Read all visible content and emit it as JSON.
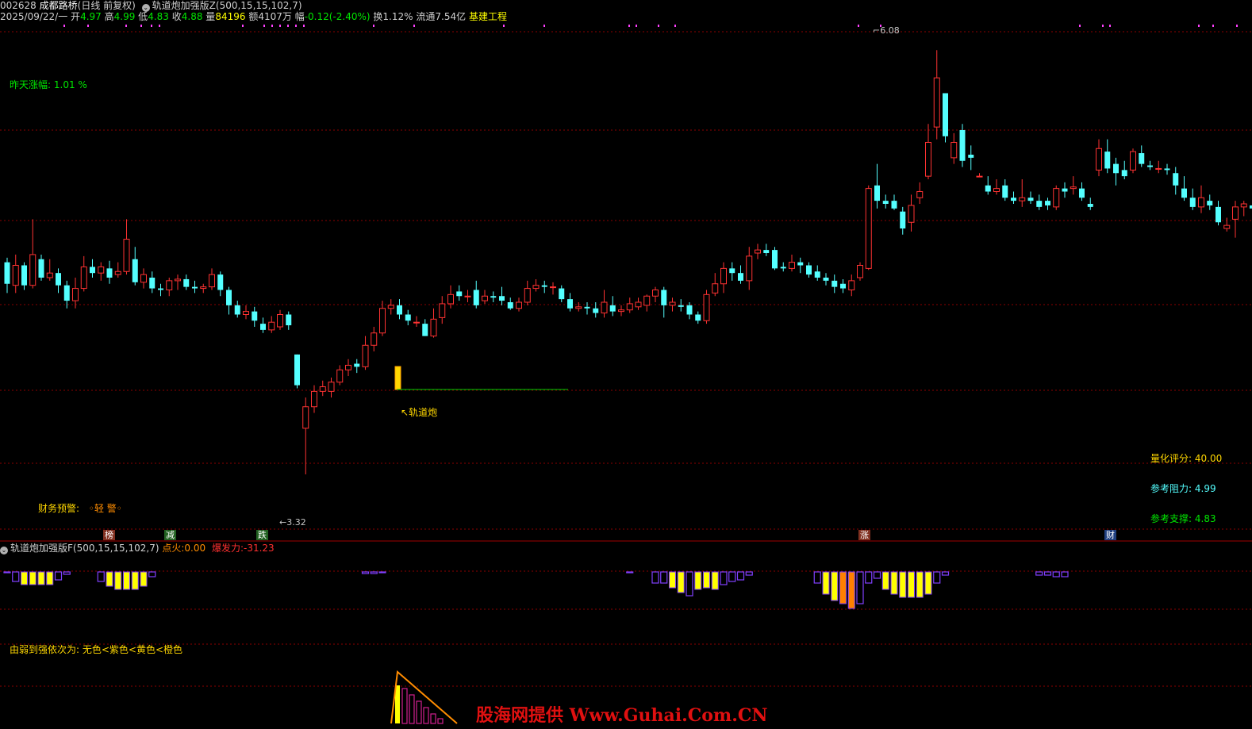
{
  "header": {
    "stock_code": "002628",
    "stock_name": "成都路桥",
    "period_mode": "(日线 前复权)",
    "indicator_main": "轨道炮加强版Z(500,15,15,102,7)",
    "date": "2025/09/22/一",
    "open_label": "开",
    "open": "4.97",
    "high_label": "高",
    "high": "4.99",
    "low_label": "低",
    "low": "4.83",
    "close_label": "收",
    "close": "4.88",
    "vol_label": "量",
    "vol": "84196",
    "amount": "额4107万",
    "chg_label": "幅",
    "chg": "-0.12(-2.40%)",
    "turnover": "换1.12%",
    "float_cap": "流通7.54亿",
    "sector": "基建工程"
  },
  "main_annotations": {
    "yesterday_label": "昨天涨幅:",
    "yesterday_value": "1.01 %",
    "max_price": "6.08",
    "min_price": "3.32",
    "signal_label": "轨道炮",
    "finance_warn_label": "财务预警:",
    "finance_warn_value": "◦轻 警◦",
    "score_label": "量化评分:",
    "score_value": "40.00",
    "resist_label": "参考阻力:",
    "resist_value": "4.99",
    "support_label": "参考支撑:",
    "support_value": "4.83"
  },
  "event_tags": [
    "榜",
    "减",
    "跌",
    "涨",
    "财"
  ],
  "sub_indicator": {
    "title": "轨道炮加强版F(500,15,15,102,7)",
    "fire_label": "点火:",
    "fire_value": "0.00",
    "burst_label": "爆发力:",
    "burst_value": "-31.23",
    "legend_note": "由弱到强依次为: 无色<紫色<黄色<橙色"
  },
  "watermark": "股海网提供 Www.Guhai.Com.CN",
  "colors": {
    "up": "#ff3232",
    "down": "#54ffff",
    "grid": "#8b0000",
    "yellow": "#ffff00",
    "purple": "#8040ff",
    "orange": "#ff8000",
    "text_green": "#00e600",
    "text_gold": "#ffd700"
  },
  "chart_data": {
    "type": "candlestick",
    "ylim": [
      3.0,
      6.2
    ],
    "candles": [
      [
        4.7,
        4.56,
        4.73,
        4.5
      ],
      [
        4.55,
        4.68,
        4.75,
        4.5
      ],
      [
        4.68,
        4.55,
        4.7,
        4.52
      ],
      [
        4.55,
        4.75,
        4.98,
        4.53
      ],
      [
        4.72,
        4.6,
        4.75,
        4.58
      ],
      [
        4.6,
        4.63,
        4.72,
        4.58
      ],
      [
        4.63,
        4.55,
        4.66,
        4.5
      ],
      [
        4.55,
        4.45,
        4.58,
        4.4
      ],
      [
        4.45,
        4.53,
        4.6,
        4.4
      ],
      [
        4.53,
        4.67,
        4.74,
        4.51
      ],
      [
        4.67,
        4.63,
        4.72,
        4.6
      ],
      [
        4.63,
        4.67,
        4.7,
        4.58
      ],
      [
        4.66,
        4.6,
        4.71,
        4.56
      ],
      [
        4.62,
        4.64,
        4.7,
        4.6
      ],
      [
        4.64,
        4.85,
        4.98,
        4.62
      ],
      [
        4.72,
        4.57,
        4.8,
        4.55
      ],
      [
        4.57,
        4.62,
        4.66,
        4.53
      ],
      [
        4.6,
        4.53,
        4.64,
        4.5
      ],
      [
        4.53,
        4.52,
        4.56,
        4.48
      ],
      [
        4.52,
        4.58,
        4.6,
        4.48
      ],
      [
        4.58,
        4.59,
        4.62,
        4.52
      ],
      [
        4.59,
        4.54,
        4.62,
        4.52
      ],
      [
        4.54,
        4.53,
        4.58,
        4.5
      ],
      [
        4.53,
        4.54,
        4.56,
        4.5
      ],
      [
        4.54,
        4.62,
        4.66,
        4.52
      ],
      [
        4.62,
        4.52,
        4.64,
        4.48
      ],
      [
        4.52,
        4.42,
        4.54,
        4.36
      ],
      [
        4.42,
        4.36,
        4.45,
        4.34
      ],
      [
        4.36,
        4.38,
        4.42,
        4.33
      ],
      [
        4.38,
        4.32,
        4.41,
        4.28
      ],
      [
        4.3,
        4.26,
        4.34,
        4.24
      ],
      [
        4.26,
        4.31,
        4.35,
        4.24
      ],
      [
        4.28,
        4.36,
        4.39,
        4.26
      ],
      [
        4.36,
        4.29,
        4.38,
        4.26
      ],
      [
        4.1,
        3.9,
        4.1,
        3.88
      ],
      [
        3.62,
        3.76,
        3.82,
        3.32
      ],
      [
        3.76,
        3.86,
        3.9,
        3.72
      ],
      [
        3.86,
        3.89,
        3.93,
        3.83
      ],
      [
        3.86,
        3.92,
        3.95,
        3.82
      ],
      [
        3.92,
        4.0,
        4.03,
        3.9
      ],
      [
        4.0,
        4.03,
        4.07,
        3.96
      ],
      [
        4.04,
        4.02,
        4.07,
        3.98
      ],
      [
        4.02,
        4.16,
        4.22,
        4.0
      ],
      [
        4.16,
        4.24,
        4.28,
        4.12
      ],
      [
        4.24,
        4.4,
        4.45,
        4.22
      ],
      [
        4.4,
        4.42,
        4.46,
        4.36
      ],
      [
        4.42,
        4.36,
        4.46,
        4.33
      ],
      [
        4.36,
        4.32,
        4.39,
        4.29
      ],
      [
        4.31,
        4.31,
        4.35,
        4.28
      ],
      [
        4.3,
        4.22,
        4.33,
        4.22
      ],
      [
        4.22,
        4.33,
        4.4,
        4.21
      ],
      [
        4.34,
        4.43,
        4.48,
        4.3
      ],
      [
        4.43,
        4.49,
        4.55,
        4.4
      ],
      [
        4.51,
        4.48,
        4.55,
        4.45
      ],
      [
        4.48,
        4.48,
        4.52,
        4.44
      ],
      [
        4.52,
        4.42,
        4.58,
        4.4
      ],
      [
        4.45,
        4.48,
        4.52,
        4.43
      ],
      [
        4.48,
        4.47,
        4.51,
        4.44
      ],
      [
        4.48,
        4.45,
        4.54,
        4.42
      ],
      [
        4.44,
        4.4,
        4.47,
        4.39
      ],
      [
        4.4,
        4.44,
        4.47,
        4.38
      ],
      [
        4.44,
        4.53,
        4.58,
        4.42
      ],
      [
        4.53,
        4.55,
        4.59,
        4.51
      ],
      [
        4.55,
        4.54,
        4.58,
        4.5
      ],
      [
        4.54,
        4.54,
        4.57,
        4.49
      ],
      [
        4.53,
        4.46,
        4.55,
        4.44
      ],
      [
        4.46,
        4.4,
        4.5,
        4.38
      ],
      [
        4.4,
        4.41,
        4.44,
        4.38
      ],
      [
        4.41,
        4.4,
        4.44,
        4.36
      ],
      [
        4.4,
        4.37,
        4.44,
        4.34
      ],
      [
        4.37,
        4.44,
        4.52,
        4.34
      ],
      [
        4.42,
        4.38,
        4.48,
        4.35
      ],
      [
        4.38,
        4.39,
        4.42,
        4.35
      ],
      [
        4.39,
        4.43,
        4.47,
        4.37
      ],
      [
        4.41,
        4.44,
        4.47,
        4.39
      ],
      [
        4.42,
        4.48,
        4.49,
        4.38
      ],
      [
        4.48,
        4.52,
        4.54,
        4.44
      ],
      [
        4.52,
        4.42,
        4.54,
        4.34
      ],
      [
        4.42,
        4.44,
        4.47,
        4.38
      ],
      [
        4.42,
        4.41,
        4.46,
        4.38
      ],
      [
        4.42,
        4.36,
        4.44,
        4.33
      ],
      [
        4.36,
        4.32,
        4.38,
        4.3
      ],
      [
        4.32,
        4.49,
        4.52,
        4.3
      ],
      [
        4.5,
        4.56,
        4.63,
        4.48
      ],
      [
        4.56,
        4.66,
        4.7,
        4.5
      ],
      [
        4.66,
        4.63,
        4.7,
        4.58
      ],
      [
        4.63,
        4.58,
        4.68,
        4.56
      ],
      [
        4.58,
        4.74,
        4.8,
        4.52
      ],
      [
        4.76,
        4.78,
        4.82,
        4.72
      ],
      [
        4.78,
        4.76,
        4.82,
        4.74
      ],
      [
        4.78,
        4.66,
        4.8,
        4.65
      ],
      [
        4.67,
        4.66,
        4.7,
        4.64
      ],
      [
        4.66,
        4.7,
        4.75,
        4.64
      ],
      [
        4.7,
        4.68,
        4.73,
        4.63
      ],
      [
        4.68,
        4.62,
        4.7,
        4.6
      ],
      [
        4.64,
        4.6,
        4.68,
        4.58
      ],
      [
        4.6,
        4.58,
        4.63,
        4.55
      ],
      [
        4.58,
        4.54,
        4.62,
        4.5
      ],
      [
        4.56,
        4.53,
        4.59,
        4.5
      ],
      [
        4.52,
        4.58,
        4.62,
        4.48
      ],
      [
        4.6,
        4.68,
        4.7,
        4.58
      ],
      [
        4.66,
        5.18,
        5.2,
        4.65
      ],
      [
        5.2,
        5.1,
        5.34,
        5.05
      ],
      [
        5.1,
        5.08,
        5.14,
        5.05
      ],
      [
        5.1,
        5.05,
        5.14,
        5.04
      ],
      [
        5.03,
        4.92,
        5.06,
        4.88
      ],
      [
        4.96,
        5.07,
        5.14,
        4.9
      ],
      [
        5.12,
        5.16,
        5.22,
        5.08
      ],
      [
        5.26,
        5.48,
        5.6,
        5.24
      ],
      [
        5.58,
        5.9,
        6.08,
        5.5
      ],
      [
        5.8,
        5.52,
        5.8,
        5.48
      ],
      [
        5.38,
        5.48,
        5.54,
        5.34
      ],
      [
        5.56,
        5.36,
        5.6,
        5.32
      ],
      [
        5.4,
        5.38,
        5.46,
        5.3
      ],
      [
        5.26,
        5.26,
        5.28,
        5.26
      ],
      [
        5.2,
        5.16,
        5.26,
        5.14
      ],
      [
        5.16,
        5.18,
        5.24,
        5.14
      ],
      [
        5.2,
        5.12,
        5.24,
        5.1
      ],
      [
        5.12,
        5.1,
        5.16,
        5.08
      ],
      [
        5.1,
        5.12,
        5.24,
        5.06
      ],
      [
        5.12,
        5.1,
        5.16,
        5.08
      ],
      [
        5.1,
        5.06,
        5.14,
        5.04
      ],
      [
        5.1,
        5.07,
        5.12,
        5.04
      ],
      [
        5.06,
        5.18,
        5.2,
        5.04
      ],
      [
        5.18,
        5.16,
        5.22,
        5.12
      ],
      [
        5.18,
        5.19,
        5.26,
        5.14
      ],
      [
        5.18,
        5.12,
        5.22,
        5.1
      ],
      [
        5.08,
        5.06,
        5.12,
        5.04
      ],
      [
        5.3,
        5.44,
        5.5,
        5.26
      ],
      [
        5.42,
        5.31,
        5.5,
        5.28
      ],
      [
        5.34,
        5.28,
        5.38,
        5.2
      ],
      [
        5.3,
        5.26,
        5.36,
        5.24
      ],
      [
        5.3,
        5.42,
        5.44,
        5.28
      ],
      [
        5.41,
        5.34,
        5.46,
        5.32
      ],
      [
        5.33,
        5.32,
        5.36,
        5.3
      ],
      [
        5.31,
        5.31,
        5.36,
        5.28
      ],
      [
        5.31,
        5.3,
        5.34,
        5.27
      ],
      [
        5.28,
        5.2,
        5.32,
        5.14
      ],
      [
        5.18,
        5.12,
        5.26,
        5.1
      ],
      [
        5.12,
        5.06,
        5.18,
        5.04
      ],
      [
        5.06,
        5.12,
        5.2,
        5.02
      ],
      [
        5.1,
        5.07,
        5.14,
        5.04
      ],
      [
        5.06,
        4.96,
        5.1,
        4.94
      ],
      [
        4.92,
        4.94,
        4.99,
        4.9
      ],
      [
        4.98,
        5.06,
        5.1,
        4.86
      ],
      [
        5.06,
        5.08,
        5.1,
        5.0
      ],
      [
        5.07,
        5.05,
        5.1,
        5.04
      ],
      [
        5.06,
        5.07,
        5.1,
        5.04
      ],
      [
        5.06,
        5.06,
        5.09,
        5.04
      ],
      [
        5.06,
        5.19,
        5.25,
        5.04
      ],
      [
        5.21,
        5.24,
        5.3,
        5.2
      ],
      [
        5.26,
        5.28,
        5.36,
        5.22
      ],
      [
        5.22,
        5.12,
        5.26,
        5.1
      ],
      [
        5.1,
        5.04,
        5.14,
        5.0
      ]
    ],
    "sub_bars": [
      {
        "i": 0,
        "h": 1,
        "c": "p"
      },
      {
        "i": 1,
        "h": 12,
        "c": "p"
      },
      {
        "i": 2,
        "h": 16,
        "c": "y"
      },
      {
        "i": 3,
        "h": 16,
        "c": "y"
      },
      {
        "i": 4,
        "h": 16,
        "c": "y"
      },
      {
        "i": 5,
        "h": 16,
        "c": "y"
      },
      {
        "i": 6,
        "h": 10,
        "c": "p"
      },
      {
        "i": 7,
        "h": 3,
        "c": "p"
      },
      {
        "i": 11,
        "h": 12,
        "c": "p"
      },
      {
        "i": 12,
        "h": 18,
        "c": "y"
      },
      {
        "i": 13,
        "h": 22,
        "c": "y"
      },
      {
        "i": 14,
        "h": 22,
        "c": "y"
      },
      {
        "i": 15,
        "h": 22,
        "c": "y"
      },
      {
        "i": 16,
        "h": 18,
        "c": "y"
      },
      {
        "i": 17,
        "h": 6,
        "c": "p"
      },
      {
        "i": 42,
        "h": 2,
        "c": "p"
      },
      {
        "i": 43,
        "h": 2,
        "c": "p"
      },
      {
        "i": 44,
        "h": 1,
        "c": "p"
      },
      {
        "i": 73,
        "h": 1,
        "c": "p"
      },
      {
        "i": 76,
        "h": 14,
        "c": "p"
      },
      {
        "i": 77,
        "h": 14,
        "c": "p"
      },
      {
        "i": 78,
        "h": 20,
        "c": "y"
      },
      {
        "i": 79,
        "h": 26,
        "c": "y"
      },
      {
        "i": 80,
        "h": 30,
        "c": "p"
      },
      {
        "i": 81,
        "h": 22,
        "c": "y"
      },
      {
        "i": 82,
        "h": 20,
        "c": "y"
      },
      {
        "i": 83,
        "h": 22,
        "c": "y"
      },
      {
        "i": 84,
        "h": 16,
        "c": "p"
      },
      {
        "i": 85,
        "h": 12,
        "c": "p"
      },
      {
        "i": 86,
        "h": 10,
        "c": "p"
      },
      {
        "i": 87,
        "h": 4,
        "c": "p"
      },
      {
        "i": 95,
        "h": 14,
        "c": "p"
      },
      {
        "i": 96,
        "h": 28,
        "c": "y"
      },
      {
        "i": 97,
        "h": 36,
        "c": "y"
      },
      {
        "i": 98,
        "h": 40,
        "c": "o"
      },
      {
        "i": 99,
        "h": 46,
        "c": "o"
      },
      {
        "i": 100,
        "h": 40,
        "c": "p"
      },
      {
        "i": 101,
        "h": 14,
        "c": "p"
      },
      {
        "i": 102,
        "h": 8,
        "c": "p"
      },
      {
        "i": 103,
        "h": 22,
        "c": "y"
      },
      {
        "i": 104,
        "h": 28,
        "c": "y"
      },
      {
        "i": 105,
        "h": 32,
        "c": "y"
      },
      {
        "i": 106,
        "h": 32,
        "c": "y"
      },
      {
        "i": 107,
        "h": 32,
        "c": "y"
      },
      {
        "i": 108,
        "h": 28,
        "c": "y"
      },
      {
        "i": 109,
        "h": 14,
        "c": "p"
      },
      {
        "i": 110,
        "h": 4,
        "c": "p"
      },
      {
        "i": 121,
        "h": 4,
        "c": "p"
      },
      {
        "i": 122,
        "h": 4,
        "c": "p"
      },
      {
        "i": 123,
        "h": 6,
        "c": "p"
      },
      {
        "i": 124,
        "h": 6,
        "c": "p"
      }
    ],
    "bottom_bars": [
      {
        "i": 0,
        "h": 48,
        "c": "y"
      },
      {
        "i": 1,
        "h": 44,
        "c": "m"
      },
      {
        "i": 2,
        "h": 36,
        "c": "m"
      },
      {
        "i": 3,
        "h": 28,
        "c": "m"
      },
      {
        "i": 4,
        "h": 20,
        "c": "m"
      },
      {
        "i": 5,
        "h": 12,
        "c": "m"
      },
      {
        "i": 6,
        "h": 6,
        "c": "m"
      }
    ]
  }
}
